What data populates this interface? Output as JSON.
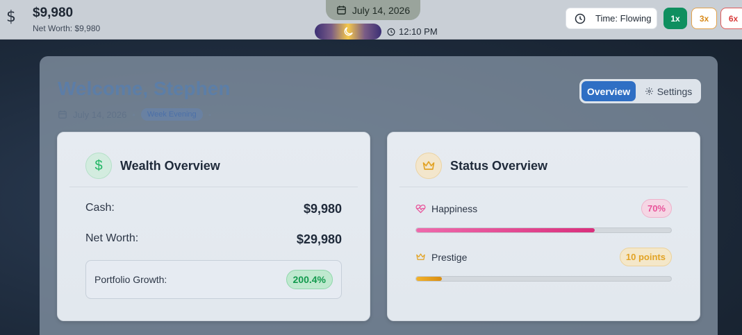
{
  "topbar": {
    "cash": "$9,980",
    "net_worth_label": "Net Worth: $9,980",
    "date": "July 14, 2026",
    "time": "12:10 PM",
    "time_mode": "Time: Flowing",
    "speeds": [
      "1x",
      "3x",
      "6x"
    ],
    "active_speed": "1x"
  },
  "header": {
    "welcome": "Welcome, Stephen",
    "date": "July 14, 2026",
    "badge": "Week Evening"
  },
  "tabs": {
    "overview": "Overview",
    "settings": "Settings",
    "active": "Overview"
  },
  "wealth": {
    "title": "Wealth Overview",
    "cash_label": "Cash:",
    "cash_value": "$9,980",
    "networth_label": "Net Worth:",
    "networth_value": "$29,980",
    "growth_label": "Portfolio Growth:",
    "growth_value": "200.4%"
  },
  "status": {
    "title": "Status Overview",
    "happiness_label": "Happiness",
    "happiness_value": "70%",
    "happiness_fraction": 0.7,
    "prestige_label": "Prestige",
    "prestige_value": "10 points",
    "prestige_fraction": 0.1
  },
  "colors": {
    "accent": "#2f6fc4",
    "positive": "#139a4e",
    "happiness": "#e8539a",
    "prestige": "#e2a325"
  }
}
